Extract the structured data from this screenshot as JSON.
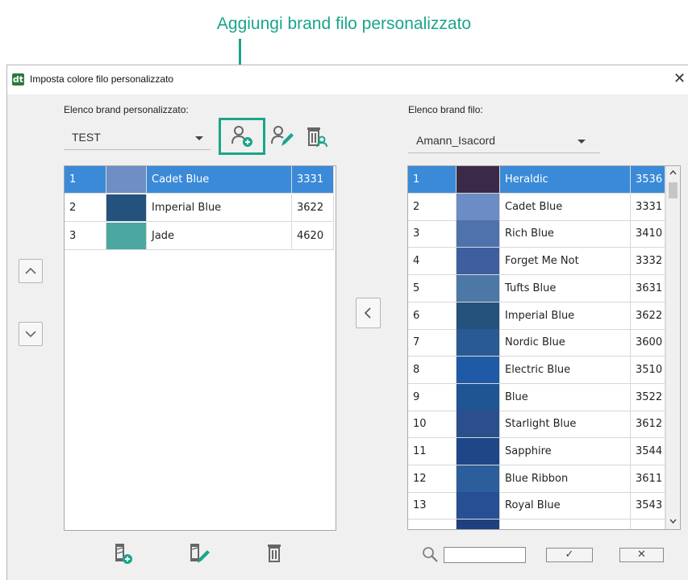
{
  "callout": {
    "text": "Aggiungi brand filo personalizzato",
    "color": "#1aa58a"
  },
  "window": {
    "title": "Imposta colore filo personalizzato",
    "close_glyph": "✕",
    "app_icon_text": "dt"
  },
  "left": {
    "label": "Elenco brand personalizzato:",
    "brand_select": "TEST",
    "rows": [
      {
        "num": "1",
        "color": "#6e8ec4",
        "name": "Cadet Blue",
        "code": "3331",
        "selected": true
      },
      {
        "num": "2",
        "color": "#25527d",
        "name": "Imperial Blue",
        "code": "3622",
        "selected": false
      },
      {
        "num": "3",
        "color": "#4aa8a0",
        "name": "Jade",
        "code": "4620",
        "selected": false
      }
    ]
  },
  "right": {
    "label": "Elenco brand filo:",
    "brand_select": "Amann_Isacord",
    "rows": [
      {
        "num": "1",
        "color": "#3a2a47",
        "name": "Heraldic",
        "code": "3536",
        "selected": true
      },
      {
        "num": "2",
        "color": "#6b8cc4",
        "name": "Cadet Blue",
        "code": "3331",
        "selected": false
      },
      {
        "num": "3",
        "color": "#4e72ab",
        "name": "Rich Blue",
        "code": "3410",
        "selected": false
      },
      {
        "num": "4",
        "color": "#3e5ea0",
        "name": "Forget Me Not",
        "code": "3332",
        "selected": false
      },
      {
        "num": "5",
        "color": "#4d77a6",
        "name": "Tufts Blue",
        "code": "3631",
        "selected": false
      },
      {
        "num": "6",
        "color": "#25527d",
        "name": "Imperial Blue",
        "code": "3622",
        "selected": false
      },
      {
        "num": "7",
        "color": "#2a5a94",
        "name": "Nordic Blue",
        "code": "3600",
        "selected": false
      },
      {
        "num": "8",
        "color": "#1f5aa6",
        "name": "Electric Blue",
        "code": "3510",
        "selected": false
      },
      {
        "num": "9",
        "color": "#1f5592",
        "name": "Blue",
        "code": "3522",
        "selected": false
      },
      {
        "num": "10",
        "color": "#2a4f8c",
        "name": "Starlight Blue",
        "code": "3612",
        "selected": false
      },
      {
        "num": "11",
        "color": "#1f4687",
        "name": "Sapphire",
        "code": "3544",
        "selected": false
      },
      {
        "num": "12",
        "color": "#2c5e9c",
        "name": "Blue Ribbon",
        "code": "3611",
        "selected": false
      },
      {
        "num": "13",
        "color": "#264f94",
        "name": "Royal Blue",
        "code": "3543",
        "selected": false
      },
      {
        "num": "",
        "color": "#1f3f80",
        "name": "",
        "code": "",
        "selected": false
      }
    ]
  },
  "buttons": {
    "ok_glyph": "✓",
    "cancel_glyph": "✕",
    "search_value": ""
  }
}
